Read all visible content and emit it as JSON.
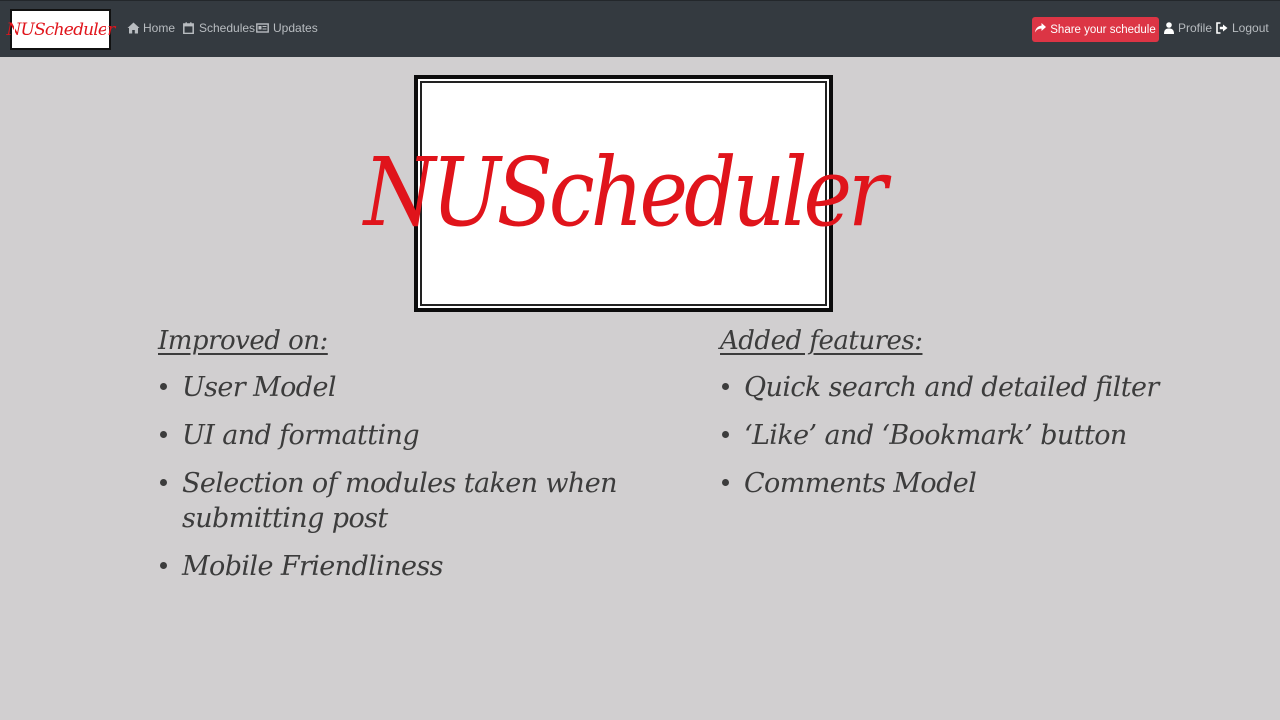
{
  "navbar": {
    "brand": "NUScheduler",
    "links": [
      {
        "label": "Home",
        "icon": "home-icon"
      },
      {
        "label": "Schedules",
        "icon": "calendar-icon"
      },
      {
        "label": "Updates",
        "icon": "newspaper-icon"
      }
    ],
    "share_button": "Share your schedule",
    "profile": "Profile",
    "logout": "Logout"
  },
  "logo": {
    "text": "NUScheduler"
  },
  "improved": {
    "title": "Improved on:",
    "items": [
      "User Model",
      "UI and formatting",
      "Selection of modules taken when submitting post",
      "Mobile Friendliness"
    ]
  },
  "added": {
    "title": "Added features:",
    "items": [
      "Quick search and detailed filter",
      "‘Like’ and ‘Bookmark’ button",
      "Comments Model"
    ]
  },
  "colors": {
    "navbar": "#343a40",
    "accent": "#dc3545",
    "brand_red": "#e0141b",
    "background": "#d1cfd0"
  }
}
